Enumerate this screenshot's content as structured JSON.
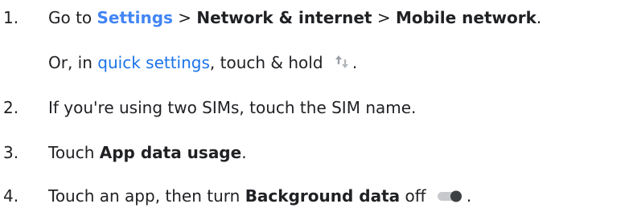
{
  "steps": [
    {
      "number": "1.",
      "parts": {
        "t1": "Go to ",
        "settings_link": "Settings",
        "sep1": " > ",
        "network": "Network & internet",
        "sep2": " > ",
        "mobile": "Mobile network",
        "end": "."
      },
      "sub": {
        "t1": "Or, in ",
        "quick_link": "quick settings",
        "t2": ", touch & hold ",
        "end": "."
      },
      "icon": "mobile-data-icon"
    },
    {
      "number": "2.",
      "text": "If you're using two SIMs, touch the SIM name."
    },
    {
      "number": "3.",
      "parts": {
        "t1": "Touch ",
        "bold": "App data usage",
        "end": "."
      }
    },
    {
      "number": "4.",
      "parts": {
        "t1": "Touch an app, then turn ",
        "bold": "Background data",
        "t2": " off ",
        "end": "."
      },
      "icon": "toggle-off-icon"
    }
  ],
  "colors": {
    "text": "#202124",
    "link": "#1a73e8",
    "icon_gray": "#9aa0a6"
  }
}
